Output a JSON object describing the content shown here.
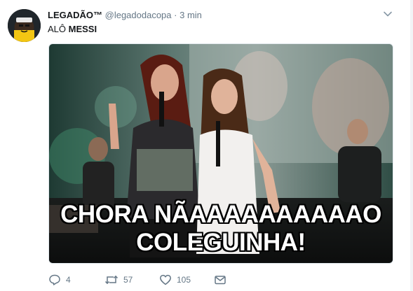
{
  "tweet": {
    "display_name": "LEGADÃO™",
    "handle": "@legadodacopa",
    "separator": "·",
    "time": "3 min",
    "text_prefix": "ALÔ",
    "text_bold": "MESSI"
  },
  "media": {
    "caption_line1": "CHORA NÃAAAAAAAAAAO",
    "caption_line2": "COLEGUINHA!"
  },
  "actions": {
    "reply_count": "4",
    "retweet_count": "57",
    "like_count": "105"
  },
  "icons": {
    "reply": "reply-icon",
    "retweet": "retweet-icon",
    "like": "heart-icon",
    "dm": "envelope-icon",
    "menu": "chevron-down-icon"
  },
  "colors": {
    "secondary_text": "#657786",
    "primary_text": "#14171a"
  }
}
